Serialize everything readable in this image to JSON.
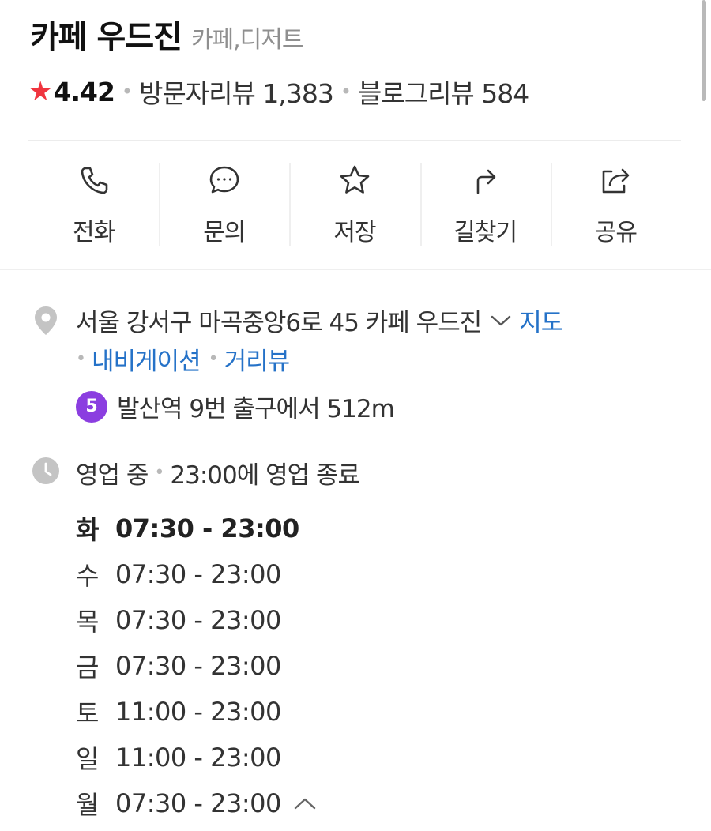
{
  "place": {
    "name": "카페 우드진",
    "category": "카페,디저트"
  },
  "rating": {
    "score": "4.42",
    "visitor_reviews": "방문자리뷰 1,383",
    "blog_reviews": "블로그리뷰 584"
  },
  "actions": [
    {
      "label": "전화",
      "icon": "phone-icon"
    },
    {
      "label": "문의",
      "icon": "chat-icon"
    },
    {
      "label": "저장",
      "icon": "star-icon"
    },
    {
      "label": "길찾기",
      "icon": "directions-icon"
    },
    {
      "label": "공유",
      "icon": "share-icon"
    }
  ],
  "address": {
    "text": "서울 강서구 마곡중앙6로 45 카페 우드진",
    "map_link": "지도",
    "navigation_link": "내비게이션",
    "streetview_link": "거리뷰"
  },
  "subway": {
    "line": "5",
    "line_color": "#8b3ee0",
    "text": "발산역 9번 출구에서 512m"
  },
  "business": {
    "status": "영업 중",
    "close_info": "23:00에 영업 종료"
  },
  "hours": [
    {
      "day": "화",
      "time": "07:30 - 23:00"
    },
    {
      "day": "수",
      "time": "07:30 - 23:00"
    },
    {
      "day": "목",
      "time": "07:30 - 23:00"
    },
    {
      "day": "금",
      "time": "07:30 - 23:00"
    },
    {
      "day": "토",
      "time": "11:00 - 23:00"
    },
    {
      "day": "일",
      "time": "11:00 - 23:00"
    },
    {
      "day": "월",
      "time": "07:30 - 23:00"
    }
  ],
  "colors": {
    "star": "#f0353f",
    "link": "#2572c8",
    "muted": "#8f8f8f"
  }
}
